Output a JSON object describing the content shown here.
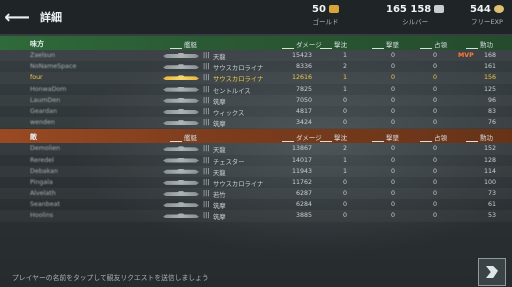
{
  "header": {
    "title": "詳細",
    "gold": {
      "value": "50",
      "label": "ゴールド"
    },
    "silver": {
      "value": "165 158",
      "label": "シルバー"
    },
    "freexp": {
      "value": "544",
      "label": "フリーEXP"
    }
  },
  "columns": {
    "ship": "艦艇",
    "damage": "ダメージ",
    "kills": "撃沈",
    "planes": "撃墜",
    "capture": "占領",
    "xp": "勲功"
  },
  "allies": {
    "label": "味方",
    "rows": [
      {
        "player": "Zaelsun",
        "tier": "|||",
        "ship": "天龍",
        "damage": "15423",
        "kills": "1",
        "planes": "0",
        "capture": "0",
        "mvp": "MVP",
        "xp": "168"
      },
      {
        "player": "NoNameSpace",
        "tier": "|||",
        "ship": "サウスカロライナ",
        "damage": "8336",
        "kills": "2",
        "planes": "0",
        "capture": "0",
        "mvp": "",
        "xp": "161"
      },
      {
        "player": "four",
        "tier": "|||",
        "ship": "サウスカロライナ",
        "damage": "12616",
        "kills": "1",
        "planes": "0",
        "capture": "0",
        "mvp": "",
        "xp": "156",
        "me": true
      },
      {
        "player": "HonwaDom",
        "tier": "|||",
        "ship": "セントルイス",
        "damage": "7825",
        "kills": "1",
        "planes": "0",
        "capture": "0",
        "mvp": "",
        "xp": "125"
      },
      {
        "player": "LaumDen",
        "tier": "|||",
        "ship": "筑摩",
        "damage": "7050",
        "kills": "0",
        "planes": "0",
        "capture": "0",
        "mvp": "",
        "xp": "96"
      },
      {
        "player": "Geardan",
        "tier": "|||",
        "ship": "ウィックス",
        "damage": "4817",
        "kills": "0",
        "planes": "0",
        "capture": "0",
        "mvp": "",
        "xp": "83"
      },
      {
        "player": "wenden",
        "tier": "|||",
        "ship": "筑摩",
        "damage": "3424",
        "kills": "0",
        "planes": "0",
        "capture": "0",
        "mvp": "",
        "xp": "76"
      }
    ]
  },
  "enemies": {
    "label": "敵",
    "rows": [
      {
        "player": "Demolien",
        "tier": "|||",
        "ship": "天龍",
        "damage": "13867",
        "kills": "2",
        "planes": "0",
        "capture": "0",
        "xp": "152"
      },
      {
        "player": "Reredel",
        "tier": "|||",
        "ship": "チェスター",
        "damage": "14017",
        "kills": "1",
        "planes": "0",
        "capture": "0",
        "xp": "128"
      },
      {
        "player": "Debakan",
        "tier": "|||",
        "ship": "天龍",
        "damage": "11943",
        "kills": "1",
        "planes": "0",
        "capture": "0",
        "xp": "114"
      },
      {
        "player": "Pingala",
        "tier": "|||",
        "ship": "サウスカロライナ",
        "damage": "11762",
        "kills": "0",
        "planes": "0",
        "capture": "0",
        "xp": "100"
      },
      {
        "player": "Alvelath",
        "tier": "|||",
        "ship": "若竹",
        "damage": "6287",
        "kills": "0",
        "planes": "0",
        "capture": "0",
        "xp": "73"
      },
      {
        "player": "Seanbeat",
        "tier": "|||",
        "ship": "筑摩",
        "damage": "6284",
        "kills": "0",
        "planes": "0",
        "capture": "0",
        "xp": "61"
      },
      {
        "player": "Hoolins",
        "tier": "|||",
        "ship": "筑摩",
        "damage": "3885",
        "kills": "0",
        "planes": "0",
        "capture": "0",
        "xp": "53"
      }
    ]
  },
  "footer": {
    "hint": "プレイヤーの名前をタップして観友リクエストを送信しましょう"
  },
  "colors": {
    "allies_header": "#2f6a3a",
    "enemies_header": "#9a4a22",
    "highlight": "#f0c84a",
    "mvp": "#ff7b3a"
  }
}
